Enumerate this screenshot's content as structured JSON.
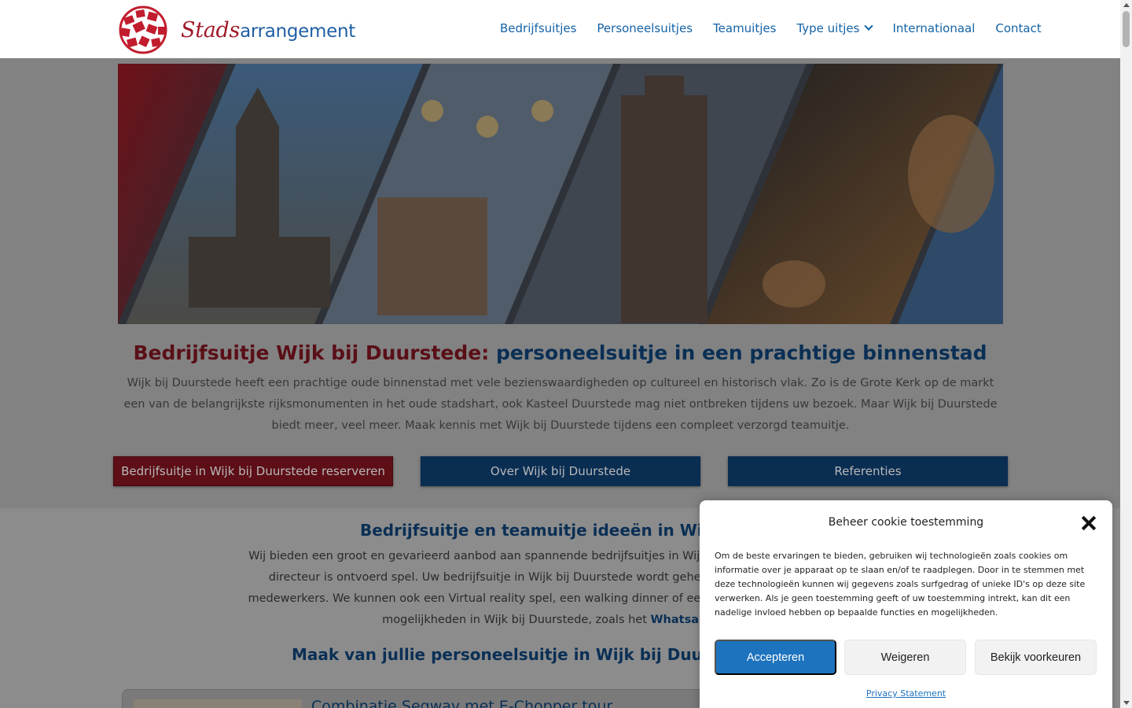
{
  "header": {
    "logo": {
      "part1": "Stads",
      "part2": "arrangement"
    },
    "nav": [
      {
        "label": "Bedrijfsuitjes"
      },
      {
        "label": "Personeelsuitjes"
      },
      {
        "label": "Teamuitjes"
      },
      {
        "label": "Type uitjes"
      },
      {
        "label": "Internationaal"
      },
      {
        "label": "Contact"
      }
    ]
  },
  "hero": {
    "alt_icon": "hero-collage-image"
  },
  "main": {
    "title_red": "Bedrijfsuitje Wijk bij Duurstede:",
    "title_blue": "personeelsuitje in een prachtige binnenstad",
    "intro": "Wijk bij Duurstede heeft een prachtige oude binnenstad met vele bezienswaardigheden op cultureel en historisch vlak. Zo is de Grote Kerk op de markt een van de belangrijkste rijksmonumenten in het oude stadshart, ook Kasteel Duurstede mag niet ontbreken tijdens uw bezoek. Maar Wijk bij Duurstede biedt meer, veel meer. Maak kennis met Wijk bij Duurstede tijdens een compleet verzorgd teamuitje.",
    "buttons": {
      "reserve": "Bedrijfsuitje in Wijk bij Duurstede reserveren",
      "about": "Over Wijk bij Duurstede",
      "refs": "Referenties"
    },
    "section2_title": "Bedrijfsuitje en teamuitje ideeën in Wijk bij Du",
    "section2_lines": [
      "Wij bieden een groot en gevarieerd aanbod aan spannende bedrijfsuitjes in Wijk bij Duurstede, zoals de Outd",
      "directeur is ontvoerd spel. Uw bedrijfsuitje in Wijk bij Duurstede wordt geheel naar wens georganiseer",
      "medewerkers. We kunnen ook een Virtual reality spel, een walking dinner of een Kraak de Code arrangement",
      "mogelijkheden in Wijk bij Duurstede, zoals het "
    ],
    "section2_link": "Whatsapp mo",
    "section3_title": "Maak van jullie personeelsuitje in Wijk bij Duurstede ee",
    "card_title": "Combinatie Segway met E-Chopper tour"
  },
  "cookie": {
    "title": "Beheer cookie toestemming",
    "text": "Om de beste ervaringen te bieden, gebruiken wij technologieën zoals cookies om informatie over je apparaat op te slaan en/of te raadplegen. Door in te stemmen met deze technologieën kunnen wij gegevens zoals surfgedrag of unieke ID's op deze site verwerken. Als je geen toestemming geeft of uw toestemming intrekt, kan dit een nadelige invloed hebben op bepaalde functies en mogelijkheden.",
    "accept": "Accepteren",
    "deny": "Weigeren",
    "prefs": "Bekijk voorkeuren",
    "privacy": "Privacy Statement"
  },
  "colors": {
    "brand_red": "#a11b2a",
    "brand_blue": "#1463a6",
    "accept_blue": "#1e73be"
  }
}
